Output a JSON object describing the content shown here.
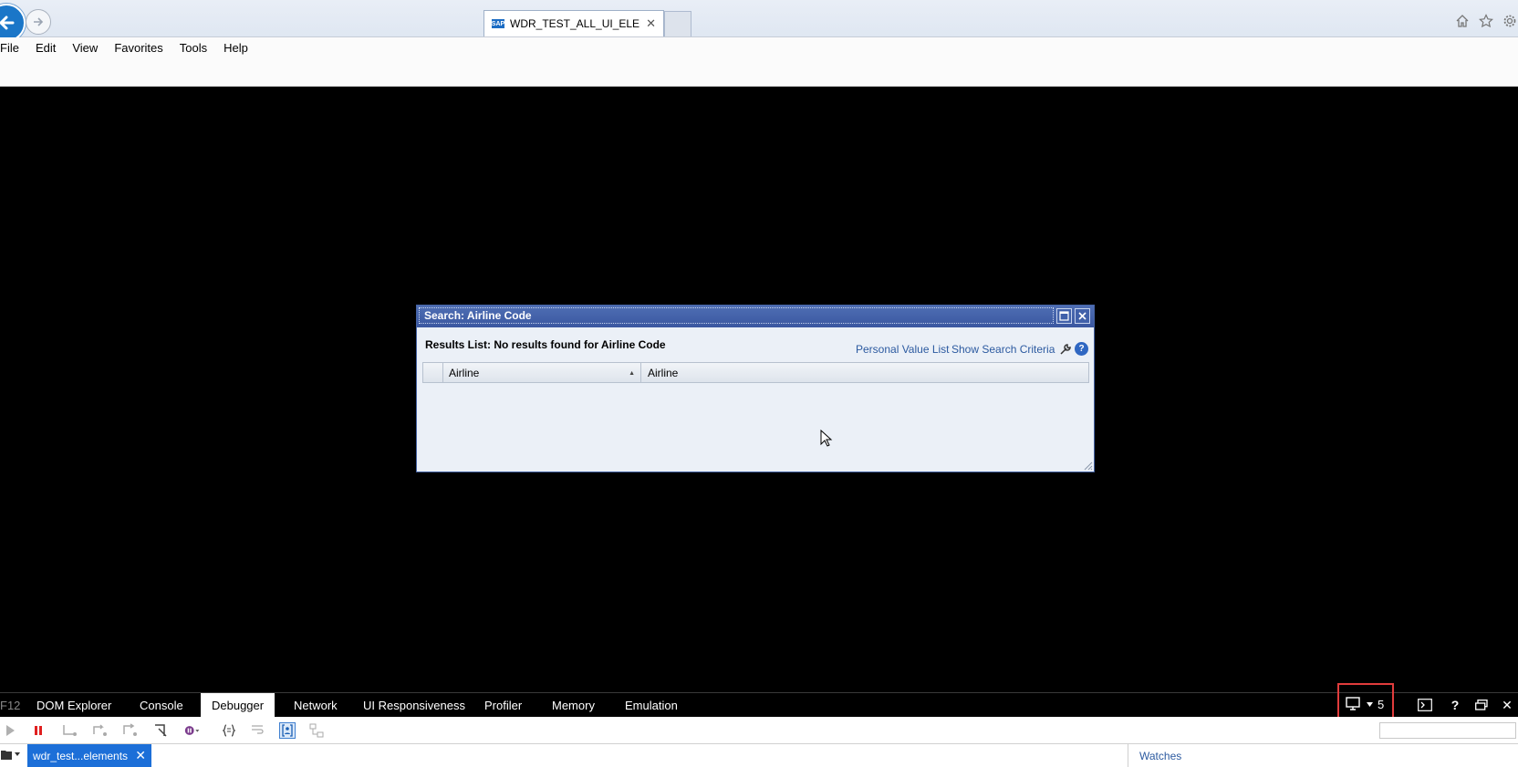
{
  "browser": {
    "tab_title": "WDR_TEST_ALL_UI_ELEME...",
    "tab_close": "✕",
    "favicon_text": "SAP",
    "menu": [
      "File",
      "Edit",
      "View",
      "Favorites",
      "Tools",
      "Help"
    ]
  },
  "dialog": {
    "title": "Search: Airline Code",
    "results_title": "Results List: No results found for Airline Code",
    "link_personal": "Personal Value List",
    "link_show": "Show Search Criteria",
    "help_glyph": "?",
    "columns": [
      "Airline",
      "Airline"
    ],
    "sort_glyph": "▲"
  },
  "devtools": {
    "f12": "F12",
    "tabs": [
      "DOM Explorer",
      "Console",
      "Debugger",
      "Network",
      "UI Responsiveness",
      "Profiler",
      "Memory",
      "Emulation"
    ],
    "active_tab": "Debugger",
    "target_count": "5",
    "help_glyph": "?",
    "close_glyph": "✕",
    "file_tab": "wdr_test...elements",
    "file_close": "✕",
    "watches": "Watches"
  },
  "colors": {
    "dialog_header": "#3f5ea6",
    "dialog_body": "#ebf0f7",
    "link": "#2c5aa0",
    "highlight_box": "#e03c3c",
    "file_tab": "#1c6fd8"
  }
}
